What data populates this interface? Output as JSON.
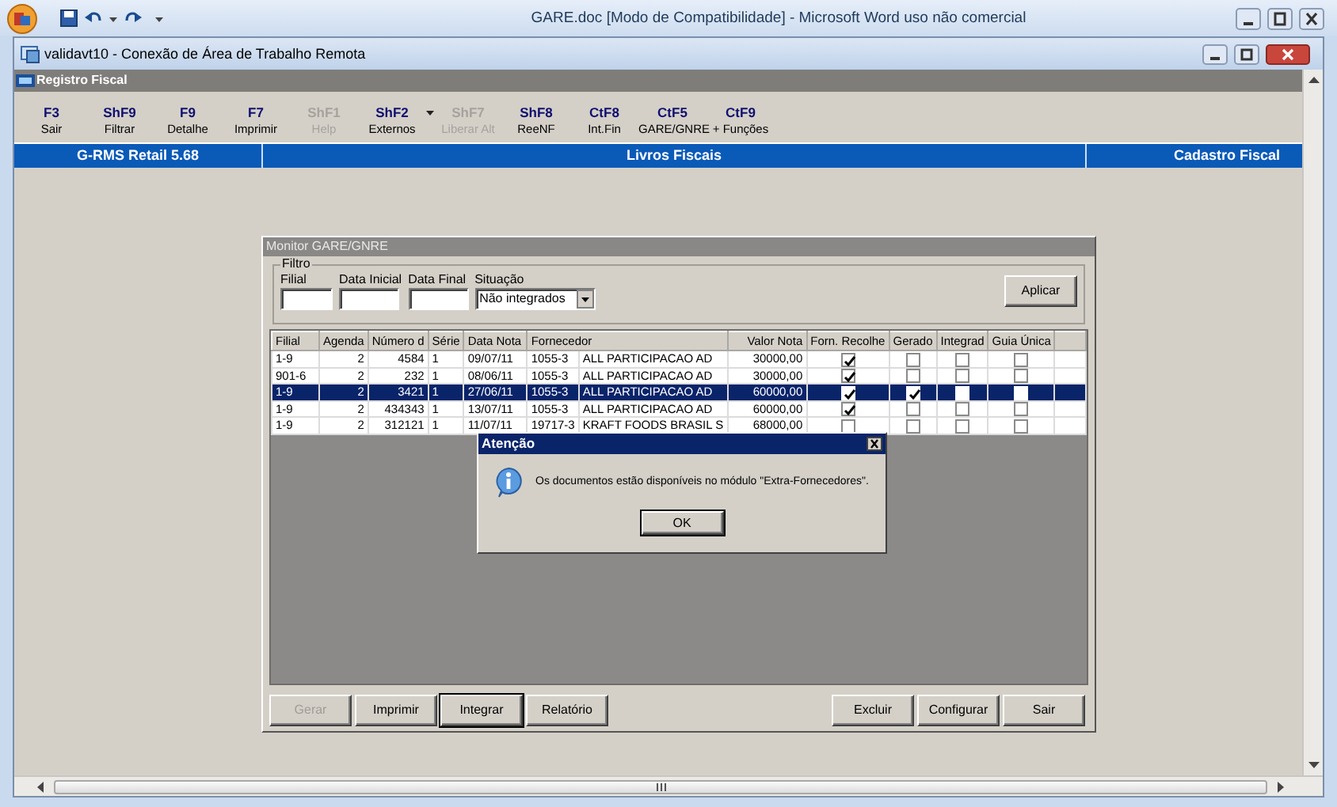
{
  "word_window": {
    "title": "GARE.doc [Modo de Compatibilidade] - Microsoft Word uso não comercial"
  },
  "remote_window": {
    "title": "validavt10 - Conexão de Área de Trabalho Remota"
  },
  "app": {
    "title": "Registro Fiscal",
    "toolbar": [
      {
        "key": "F3",
        "label": "Sair",
        "disabled": false,
        "has_menu": false
      },
      {
        "key": "ShF9",
        "label": "Filtrar",
        "disabled": false,
        "has_menu": false
      },
      {
        "key": "F9",
        "label": "Detalhe",
        "disabled": false,
        "has_menu": false
      },
      {
        "key": "F7",
        "label": "Imprimir",
        "disabled": false,
        "has_menu": false
      },
      {
        "key": "ShF1",
        "label": "Help",
        "disabled": true,
        "has_menu": false
      },
      {
        "key": "ShF2",
        "label": "Externos",
        "disabled": false,
        "has_menu": true
      },
      {
        "key": "ShF7",
        "label": "Liberar Alt",
        "disabled": true,
        "has_menu": false
      },
      {
        "key": "ShF8",
        "label": "ReeNF",
        "disabled": false,
        "has_menu": false
      },
      {
        "key": "CtF8",
        "label": "Int.Fin",
        "disabled": false,
        "has_menu": false
      },
      {
        "key": "CtF5",
        "label": "GARE/GNRE",
        "disabled": false,
        "has_menu": false
      },
      {
        "key": "CtF9",
        "label": "+ Funções",
        "disabled": false,
        "has_menu": false
      }
    ],
    "nav_bar": [
      "G-RMS Retail 5.68",
      "Livros Fiscais",
      "Cadastro Fiscal"
    ]
  },
  "monitor": {
    "title": "Monitor GARE/GNRE",
    "filter": {
      "legend": "Filtro",
      "fields": [
        {
          "label": "Filial"
        },
        {
          "label": "Data Inicial"
        },
        {
          "label": "Data Final"
        }
      ],
      "situacao": {
        "label": "Situação",
        "value": "Não integrados"
      },
      "apply_button": "Aplicar"
    },
    "table": {
      "columns": [
        "Filial",
        "Agenda",
        "Número d",
        "Série",
        "Data Nota",
        "Fornecedor",
        "Valor Nota",
        "Forn. Recolhe",
        "Gerado",
        "Integrad",
        "Guia Única"
      ],
      "rows": [
        {
          "filial": "1-9",
          "agenda": "2",
          "numero": "4584",
          "serie": "1",
          "data": "09/07/11",
          "fornecedor_code": "1055-3",
          "fornecedor_name": "ALL PARTICIPACAO AD",
          "valor": "30000,00",
          "forn_recolhe": true,
          "gerado": false,
          "integrado": false,
          "guia_unica": false,
          "selected": false
        },
        {
          "filial": "901-6",
          "agenda": "2",
          "numero": "232",
          "serie": "1",
          "data": "08/06/11",
          "fornecedor_code": "1055-3",
          "fornecedor_name": "ALL PARTICIPACAO AD",
          "valor": "30000,00",
          "forn_recolhe": true,
          "gerado": false,
          "integrado": false,
          "guia_unica": false,
          "selected": false
        },
        {
          "filial": "1-9",
          "agenda": "2",
          "numero": "3421",
          "serie": "1",
          "data": "27/06/11",
          "fornecedor_code": "1055-3",
          "fornecedor_name": "ALL PARTICIPACAO AD",
          "valor": "60000,00",
          "forn_recolhe": true,
          "gerado": true,
          "integrado": false,
          "guia_unica": false,
          "selected": true
        },
        {
          "filial": "1-9",
          "agenda": "2",
          "numero": "434343",
          "serie": "1",
          "data": "13/07/11",
          "fornecedor_code": "1055-3",
          "fornecedor_name": "ALL PARTICIPACAO AD",
          "valor": "60000,00",
          "forn_recolhe": true,
          "gerado": false,
          "integrado": false,
          "guia_unica": false,
          "selected": false
        },
        {
          "filial": "1-9",
          "agenda": "2",
          "numero": "312121",
          "serie": "1",
          "data": "11/07/11",
          "fornecedor_code": "19717-3",
          "fornecedor_name": "KRAFT FOODS BRASIL S",
          "valor": "68000,00",
          "forn_recolhe": false,
          "gerado": false,
          "integrado": false,
          "guia_unica": false,
          "selected": false
        }
      ]
    },
    "buttons_left": [
      {
        "label": "Gerar",
        "disabled": true,
        "focused": false
      },
      {
        "label": "Imprimir",
        "disabled": false,
        "focused": false
      },
      {
        "label": "Integrar",
        "disabled": false,
        "focused": true
      },
      {
        "label": "Relatório",
        "disabled": false,
        "focused": false
      }
    ],
    "buttons_right": [
      {
        "label": "Excluir",
        "disabled": false,
        "focused": false
      },
      {
        "label": "Configurar",
        "disabled": false,
        "focused": false
      },
      {
        "label": "Sair",
        "disabled": false,
        "focused": false
      }
    ]
  },
  "alert": {
    "title": "Atenção",
    "message": "Os documentos estão disponíveis no módulo \"Extra-Fornecedores\".",
    "ok_button": "OK"
  }
}
